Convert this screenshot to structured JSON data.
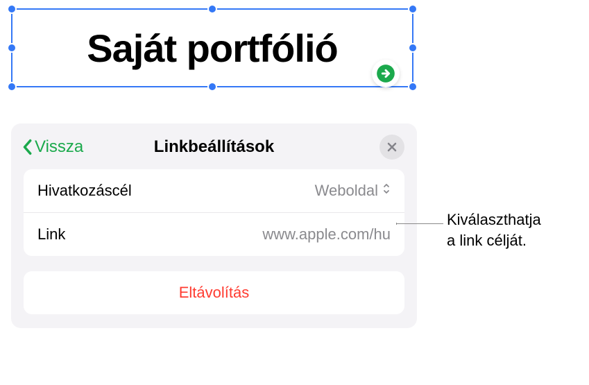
{
  "canvas": {
    "title_text": "Saját portfólió"
  },
  "panel": {
    "back_label": "Vissza",
    "title": "Linkbeállítások",
    "rows": {
      "target_label": "Hivatkozáscél",
      "target_value": "Weboldal",
      "link_label": "Link",
      "link_placeholder": "www.apple.com/hu"
    },
    "remove_label": "Eltávolítás"
  },
  "callout": {
    "line1": "Kiválaszthatja",
    "line2": "a link célját."
  },
  "colors": {
    "accent_green": "#1ba94c",
    "selection_blue": "#3478f6",
    "danger_red": "#ff3b30",
    "muted_gray": "#8a8a8e"
  }
}
